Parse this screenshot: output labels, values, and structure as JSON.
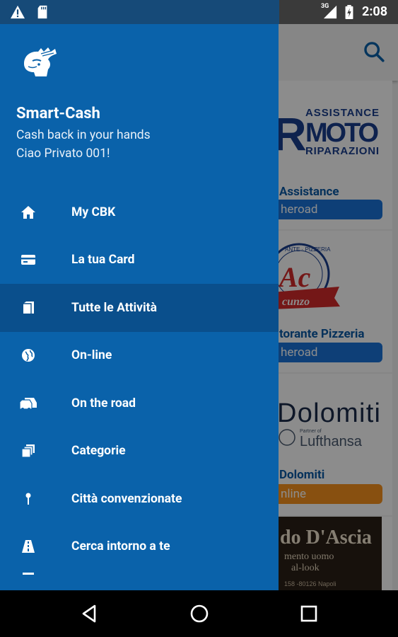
{
  "status_bar": {
    "time": "2:08",
    "network": "3G",
    "icons": [
      "warning-icon",
      "sd-card-icon",
      "signal-icon",
      "battery-charging-icon"
    ]
  },
  "background": {
    "cards": [
      {
        "title": "Assistance",
        "chip": "heroad",
        "chip_color": "#1a73d9"
      },
      {
        "title": "torante Pizzeria",
        "chip": "heroad",
        "chip_color": "#1a73d9"
      },
      {
        "title": "Dolomiti",
        "chip": "nline",
        "chip_color": "#f7931e"
      }
    ],
    "logos": {
      "moto": {
        "line1": "ASSISTANCE",
        "line2": "MOTO",
        "line3": "RIPARAZIONI",
        "letter": "R"
      },
      "pizza": {
        "arc": "ANTE · PIZZERIA",
        "mark": "Ac",
        "ribbon": "cunzo"
      },
      "dolomiti": {
        "brand": "Dolomiti",
        "partner": "Partner of",
        "airline": "Lufthansa"
      },
      "ascia": {
        "title": "do D'Ascia",
        "line1": "mento uomo",
        "line2": "al-look",
        "line3": "158 -80126 Napoli"
      }
    }
  },
  "drawer": {
    "app_name": "Smart-Cash",
    "tagline": "Cash back in your hands",
    "greeting": "Ciao Privato 001!",
    "items": [
      {
        "label": "My CBK",
        "icon": "home-icon",
        "active": false
      },
      {
        "label": "La tua Card",
        "icon": "credit-card-icon",
        "active": false
      },
      {
        "label": "Tutte le Attività",
        "icon": "shopping-bag-icon",
        "active": true
      },
      {
        "label": "On-line",
        "icon": "globe-icon",
        "active": false
      },
      {
        "label": "On the road",
        "icon": "car-icon",
        "active": false
      },
      {
        "label": "Categorie",
        "icon": "layers-icon",
        "active": false
      },
      {
        "label": "Città convenzionate",
        "icon": "pin-icon",
        "active": false
      },
      {
        "label": "Cerca intorno a te",
        "icon": "road-icon",
        "active": false
      }
    ]
  },
  "nav_bar": {
    "buttons": [
      "back-button",
      "home-button",
      "recents-button"
    ]
  }
}
